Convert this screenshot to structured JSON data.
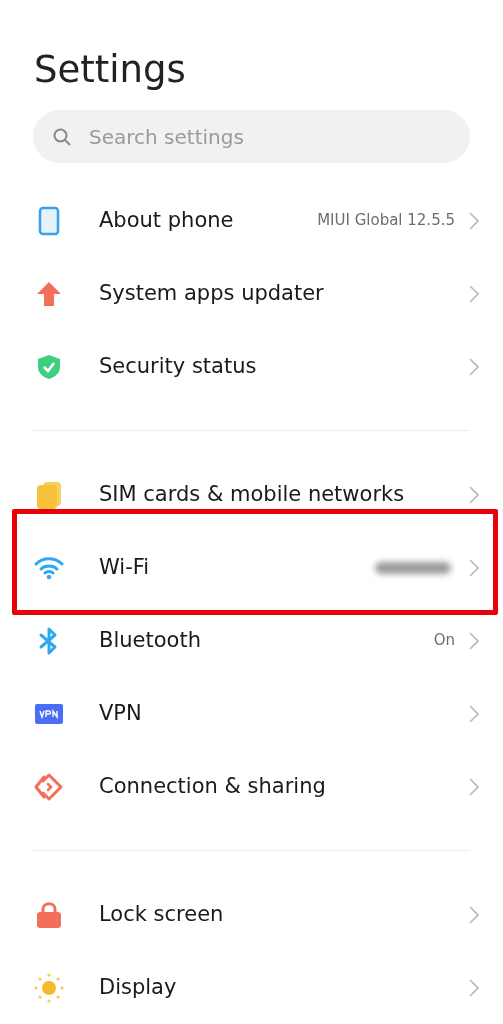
{
  "title": "Settings",
  "search": {
    "placeholder": "Search settings"
  },
  "sections": [
    {
      "items": [
        {
          "kind": "phone",
          "label": "About phone",
          "value": "MIUI Global 12.5.5",
          "highlighted": false
        },
        {
          "kind": "update",
          "label": "System apps updater",
          "highlighted": false
        },
        {
          "kind": "shield",
          "label": "Security status",
          "highlighted": false
        }
      ]
    },
    {
      "items": [
        {
          "kind": "sim",
          "label": "SIM cards & mobile networks",
          "highlighted": false
        },
        {
          "kind": "wifi",
          "label": "Wi-Fi",
          "value_redacted": true,
          "highlighted": true
        },
        {
          "kind": "bluetooth",
          "label": "Bluetooth",
          "value": "On",
          "highlighted": false
        },
        {
          "kind": "vpn",
          "label": "VPN",
          "highlighted": false
        },
        {
          "kind": "share",
          "label": "Connection & sharing",
          "highlighted": false
        }
      ]
    },
    {
      "items": [
        {
          "kind": "lock",
          "label": "Lock screen",
          "highlighted": false
        },
        {
          "kind": "sun",
          "label": "Display",
          "highlighted": false
        }
      ]
    }
  ]
}
